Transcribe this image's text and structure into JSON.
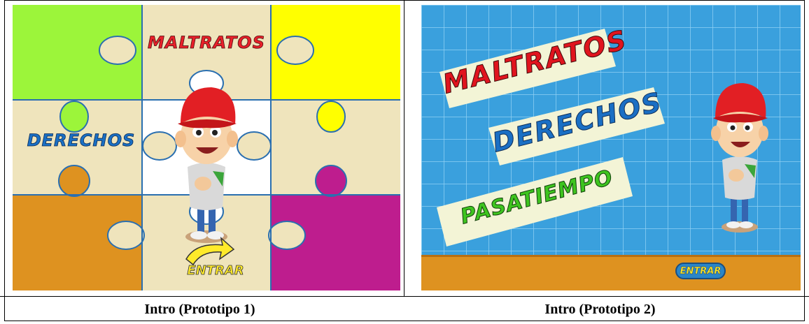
{
  "prototype1": {
    "menu": {
      "maltratos_label": "MALTRATOS",
      "derechos_label": "DERECHOS",
      "entrar_label": "ENTRAR"
    },
    "colors": {
      "green": "#9cf53a",
      "yellow": "#ffff00",
      "cream": "#efe4bc",
      "white": "#ffffff",
      "orange": "#de9220",
      "magenta": "#be1d8e",
      "outline": "#2a6fb0",
      "label_red": "#e8202a",
      "label_blue": "#1a6fc4",
      "arrow_yellow": "#ffea2a"
    }
  },
  "prototype2": {
    "menu": {
      "maltratos_label": "MALTRATOS",
      "derechos_label": "DERECHOS",
      "pasatiempo_label": "PASATIEMPO",
      "entrar_label": "ENTRAR"
    },
    "colors": {
      "background": "#3aa0dd",
      "grid": "#8fd0f3",
      "floor": "#de9220",
      "banner": "#f3f4d6",
      "label_red": "#e0141e",
      "label_blue": "#1a6fc4",
      "label_green": "#3ec41f"
    }
  },
  "captions": {
    "left": "Intro (Prototipo 1)",
    "right": "Intro (Prototipo 2)"
  }
}
